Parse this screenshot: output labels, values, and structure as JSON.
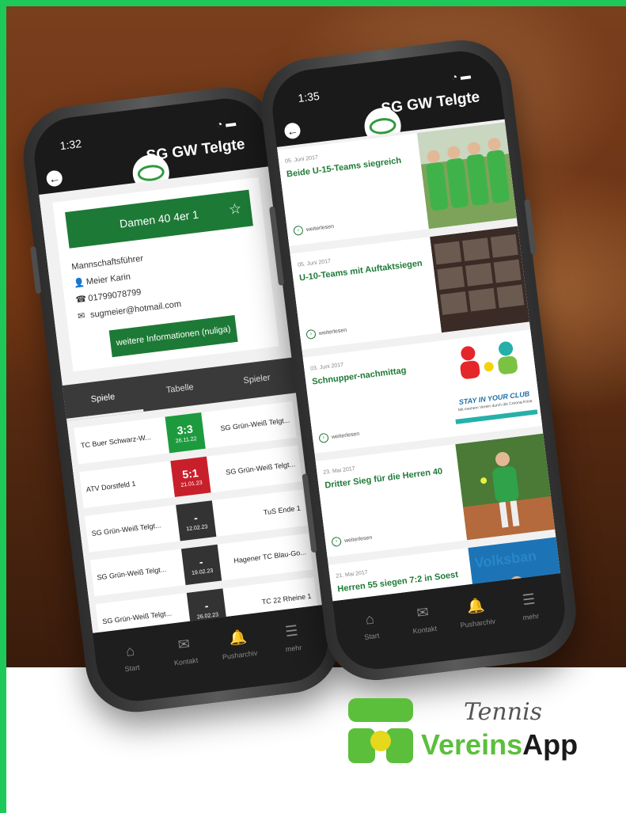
{
  "left_phone": {
    "time": "1:32",
    "club_name": "SG GW Telgte",
    "team_button": "Damen 40 4er 1",
    "captain_heading": "Mannschaftsführer",
    "captain_name": "Meier Karin",
    "captain_phone": "01799078799",
    "captain_email": "sugmeier@hotmail.com",
    "info_button": "weitere Informationen (nuliga)",
    "tabs": [
      "Spiele",
      "Tabelle",
      "Spieler"
    ],
    "matches": [
      {
        "home": "TC Buer Schwarz-W...",
        "score": "3:3",
        "date": "26.11.22",
        "away": "SG Grün-Weiß Telgt...",
        "result": "win"
      },
      {
        "home": "ATV Dorstfeld 1",
        "score": "5:1",
        "date": "21.01.23",
        "away": "SG Grün-Weiß Telgt...",
        "result": "loss"
      },
      {
        "home": "SG Grün-Weiß Telgt...",
        "score": "-",
        "date": "12.02.23",
        "away": "TuS Ende 1",
        "result": "open"
      },
      {
        "home": "SG Grün-Weiß Telgt...",
        "score": "-",
        "date": "19.02.23",
        "away": "Hagener TC Blau-Go...",
        "result": "open"
      },
      {
        "home": "SG Grün-Weiß Telgt...",
        "score": "-",
        "date": "26.02.23",
        "away": "TC 22 Rheine 1",
        "result": "open"
      }
    ]
  },
  "right_phone": {
    "time": "1:35",
    "club_name": "SG GW Telgte",
    "read_more": "weiterlesen",
    "news": [
      {
        "date": "05. Juni 2017",
        "title": "Beide U-15-Teams siegreich"
      },
      {
        "date": "05. Juni 2017",
        "title": "U-10-Teams mit Auftaktsiegen"
      },
      {
        "date": "03. Juni 2017",
        "title": "Schnupper-nachmittag"
      },
      {
        "date": "23. Mai 2017",
        "title": "Dritter Sieg für die Herren 40"
      },
      {
        "date": "21. Mai 2017",
        "title": "Herren 55 siegen 7:2 in Soest"
      }
    ],
    "ad": {
      "headline": "STAY IN YOUR CLUB",
      "sub": "Mit meinem Verein durch die Corona-Krise"
    },
    "banner_word": "Volksban"
  },
  "nav": {
    "items": [
      {
        "label": "Start",
        "icon": "home-icon"
      },
      {
        "label": "Kontakt",
        "icon": "mail-icon"
      },
      {
        "label": "Pusharchiv",
        "icon": "bell-icon"
      },
      {
        "label": "mehr",
        "icon": "menu-icon"
      }
    ]
  },
  "brand": {
    "line1": "Tennis",
    "line2_green": "Vereins",
    "line2_dark": "App"
  },
  "colors": {
    "accent_green": "#1d7a36",
    "win": "#1d9a3e",
    "loss": "#c8202b",
    "border_green": "#1ec95a"
  }
}
